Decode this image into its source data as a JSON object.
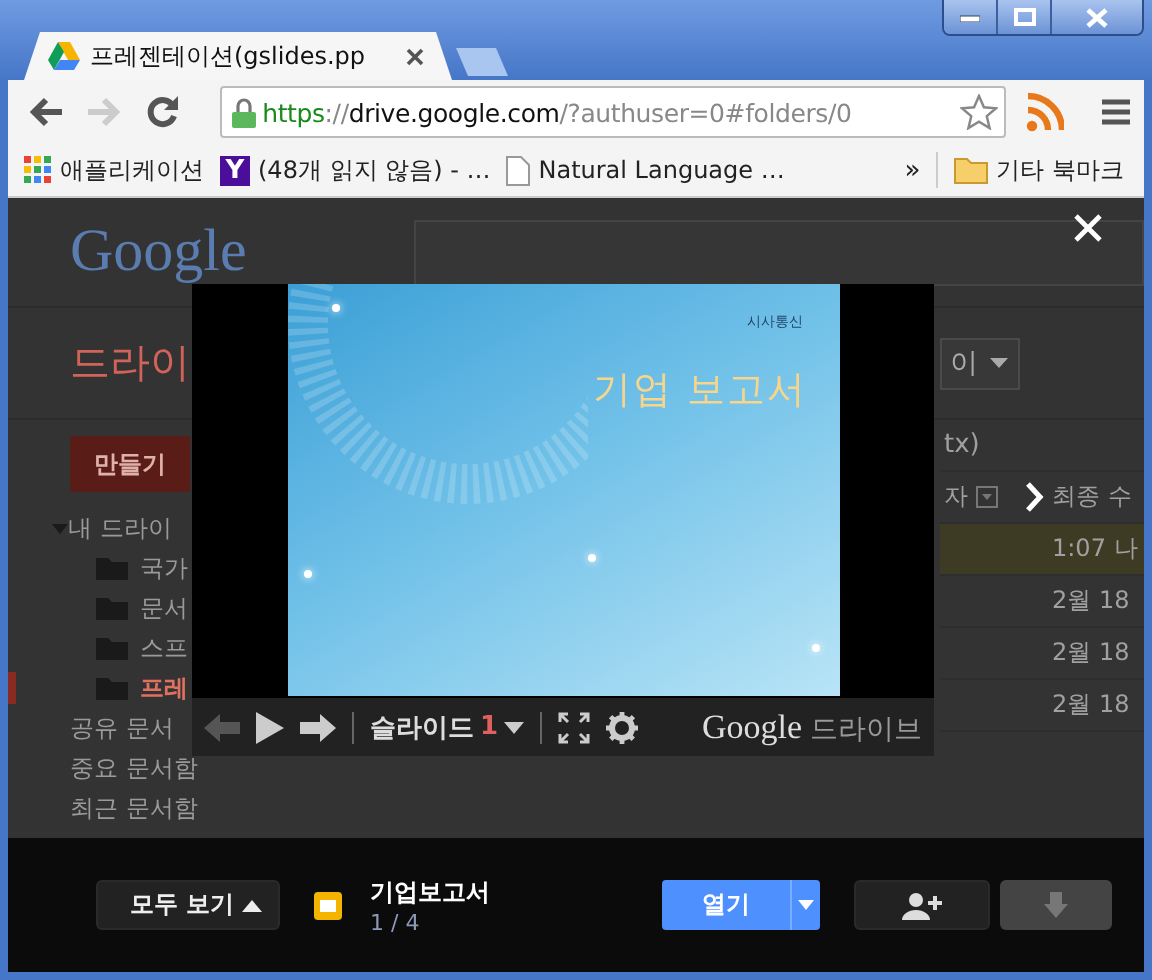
{
  "tab": {
    "title": "프레젠테이션(gslides.pp",
    "selected": true
  },
  "navigation": {
    "back_disabled": false,
    "forward_disabled": true
  },
  "address_bar": {
    "scheme": "https",
    "separator": "://",
    "host": "drive.google.com",
    "rest": "/?authuser=0#folders/0"
  },
  "bookmarks": [
    {
      "kind": "apps",
      "label": "애플리케이션"
    },
    {
      "kind": "yahoo",
      "badge": "Y",
      "label": "(48개 읽지 않음) - …"
    },
    {
      "kind": "page",
      "label": "Natural Language …"
    }
  ],
  "bookmarks_overflow": "»",
  "other_bookmarks": "기타 북마크",
  "drive_page": {
    "logo": "Google",
    "title": "드라이",
    "create_button": "만들기",
    "tree": [
      {
        "label": "내 드라이",
        "expanded": true,
        "selected": false,
        "children": [
          {
            "label": "국가",
            "selected": false
          },
          {
            "label": "문서",
            "selected": false
          },
          {
            "label": "스프",
            "selected": false
          },
          {
            "label": "프레",
            "selected": true
          }
        ]
      }
    ],
    "nav": [
      "공유 문서",
      "중요 문서함",
      "최근 문서함"
    ],
    "view_dropdown": "이",
    "file_name_fragment": "tx)",
    "columns": [
      "자",
      "최종 수"
    ],
    "rows": [
      {
        "modified": "1:07 나",
        "selected": true
      },
      {
        "modified": "2월 18",
        "selected": false
      },
      {
        "modified": "2월 18",
        "selected": false
      },
      {
        "modified": "2월 18",
        "selected": false
      }
    ]
  },
  "viewer": {
    "slide": {
      "publisher": "시사통신",
      "title": "기업 보고서"
    },
    "previous_disabled": true,
    "slide_label": "슬라이드",
    "slide_number": "1",
    "brand": {
      "logo": "Google",
      "product": "드라이브"
    }
  },
  "bottom_bar": {
    "view_all": "모두 보기",
    "file": {
      "title": "기업보고서",
      "position": "1 / 4"
    },
    "open_button": "열기",
    "download_disabled": true
  }
}
